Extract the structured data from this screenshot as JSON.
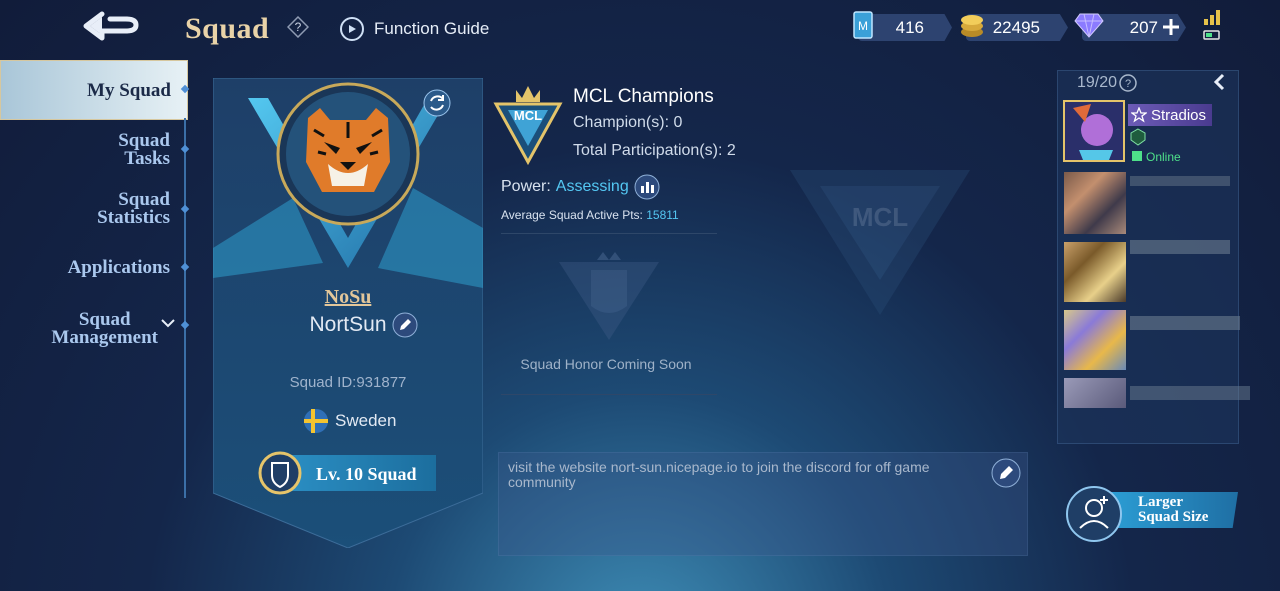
{
  "header": {
    "title": "Squad",
    "guide_label": "Function Guide",
    "resources": {
      "tickets": "416",
      "gold": "22495",
      "diamonds": "207"
    }
  },
  "nav": {
    "items": [
      {
        "label": "My Squad",
        "active": true
      },
      {
        "label": "Squad\nTasks"
      },
      {
        "label": "Squad\nStatistics"
      },
      {
        "label": "Applications"
      },
      {
        "label": "Squad\nManagement"
      }
    ]
  },
  "squad": {
    "abbr": "NoSu",
    "name": "NortSun",
    "id_text": "Squad ID:931877",
    "country": "Sweden",
    "level": "Lv. 10 Squad"
  },
  "mcl": {
    "badge": "MCL",
    "title": "MCL Champions",
    "champions": "Champion(s): 0",
    "participation": "Total Participation(s): 2"
  },
  "power": {
    "label": "Power:",
    "value": "Assessing"
  },
  "activity": {
    "label": "Average Squad Active Pts:",
    "value": "15811"
  },
  "honor": {
    "text": "Squad Honor Coming Soon"
  },
  "description": {
    "text": "visit the website nort-sun.nicepage.io to join the discord for off game community"
  },
  "roster": {
    "count": "19/20",
    "leader_name": "Stradios",
    "leader_status": "Online"
  },
  "larger_squad": {
    "label": "Larger\nSquad Size"
  },
  "colors": {
    "accent": "#54c7f2",
    "title_gold": "#e9d3a8",
    "online": "#4ee08a"
  }
}
